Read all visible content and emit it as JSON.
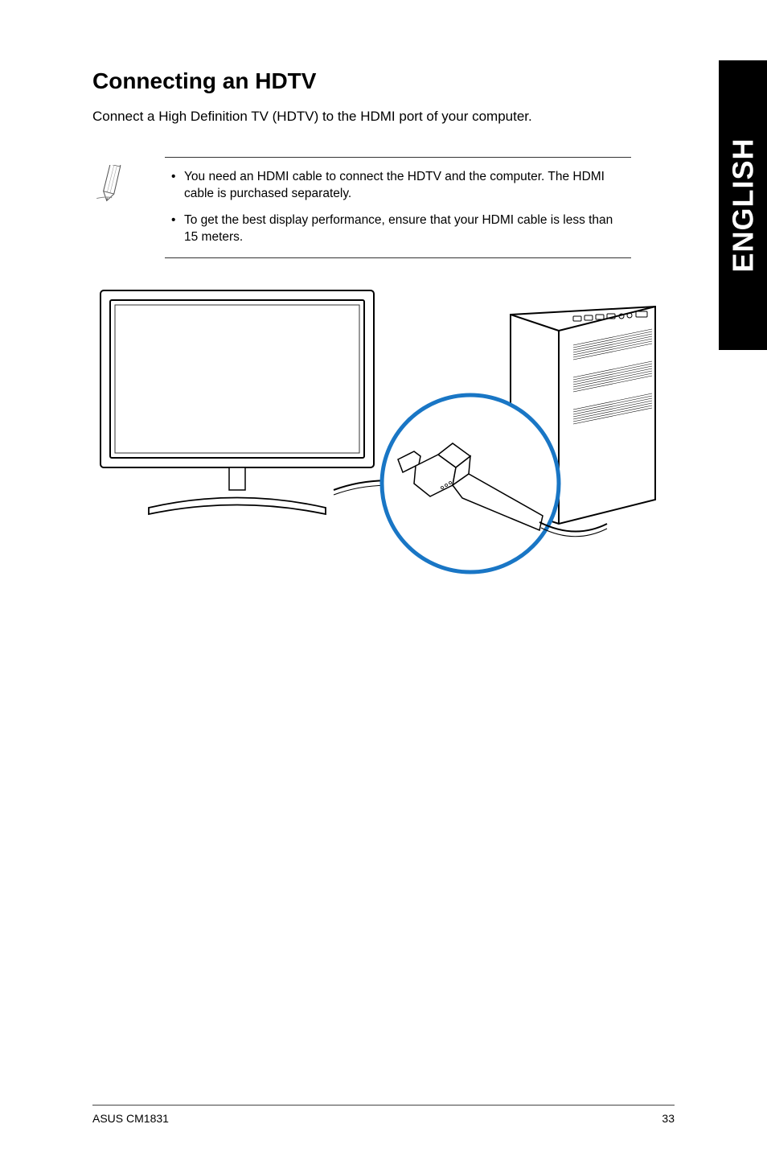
{
  "side_tab": "ENGLISH",
  "heading": "Connecting an HDTV",
  "intro": "Connect a High Definition TV (HDTV) to the HDMI port of your computer.",
  "notes": {
    "item1": "You need an HDMI cable to connect the HDTV and the computer. The HDMI cable is purchased separately.",
    "item2": "To get the best display performance, ensure that your HDMI cable is less than 15 meters."
  },
  "footer": {
    "left": "ASUS CM1831",
    "right": "33"
  }
}
